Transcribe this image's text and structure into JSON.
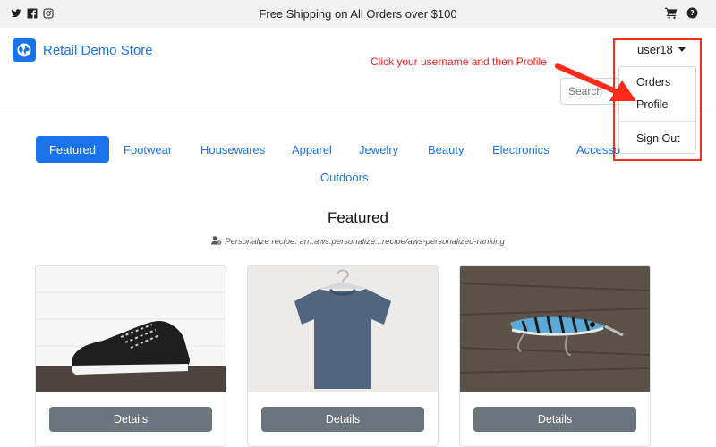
{
  "topbar": {
    "promo": "Free Shipping on All Orders over $100",
    "social_icons": [
      "twitter-icon",
      "facebook-icon",
      "instagram-icon"
    ],
    "right_icons": [
      "cart-icon",
      "help-icon"
    ]
  },
  "header": {
    "store_name": "Retail Demo Store",
    "search_placeholder": "Search",
    "username": "user18"
  },
  "user_menu": {
    "items": [
      "Orders",
      "Profile",
      "Sign Out"
    ]
  },
  "annotation": {
    "text": "Click your username and then Profile"
  },
  "categories": [
    "Featured",
    "Footwear",
    "Housewares",
    "Apparel",
    "Jewelry",
    "Beauty",
    "Electronics",
    "Accesso",
    "Outdoors"
  ],
  "section": {
    "title": "Featured",
    "recipe": "Personalize recipe: arn:aws:personalize:::recipe/aws-personalized-ranking"
  },
  "products": [
    {
      "image": "sneaker",
      "button": "Details"
    },
    {
      "image": "t-shirt",
      "button": "Details"
    },
    {
      "image": "fishing-lure",
      "button": "Details"
    }
  ],
  "colors": {
    "accent": "#1a73e8",
    "annotation": "#ff1a1a",
    "button": "#6c757d"
  }
}
